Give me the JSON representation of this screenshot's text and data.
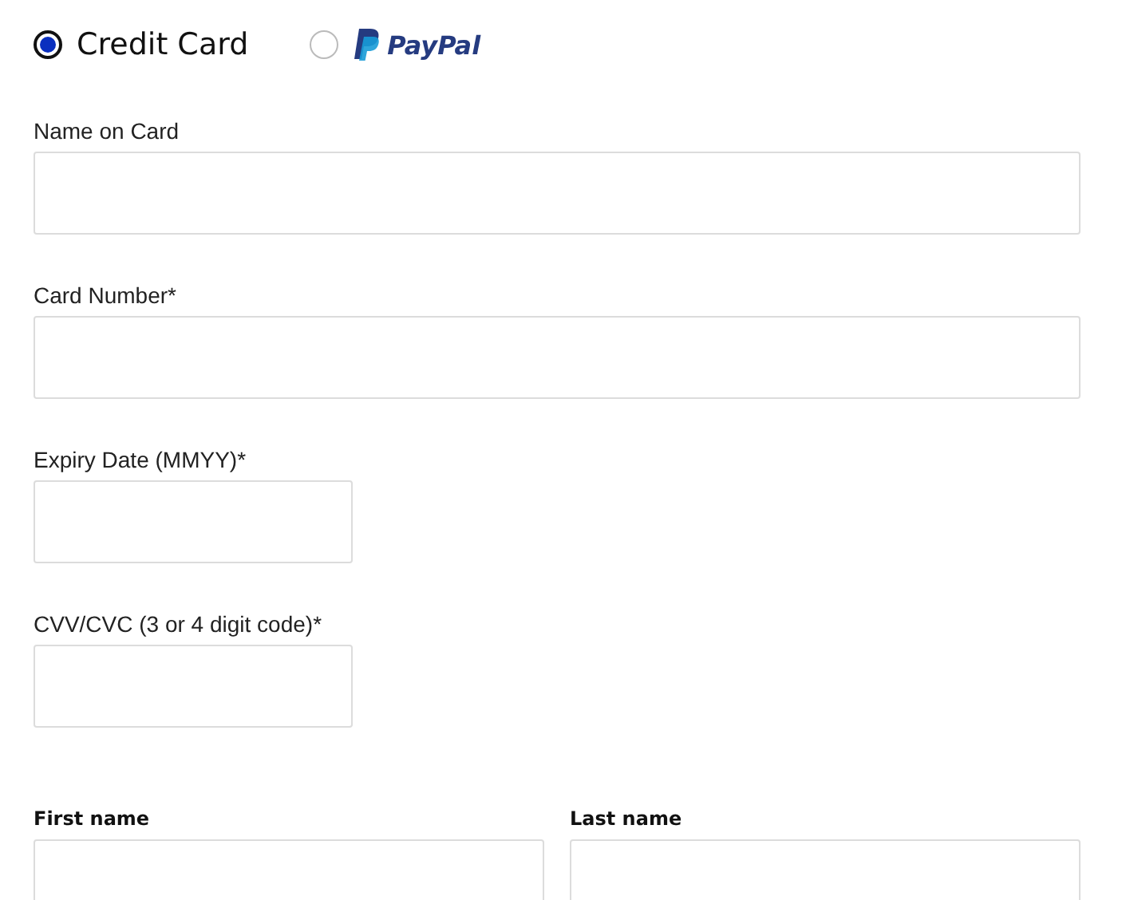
{
  "payment_methods": [
    {
      "label": "Credit Card",
      "selected": true,
      "kind": "text"
    },
    {
      "label": "PayPal",
      "selected": false,
      "kind": "logo"
    }
  ],
  "card_fields": [
    {
      "label": "Name on Card",
      "kind": "wide"
    },
    {
      "label": "Card Number*",
      "kind": "wide"
    },
    {
      "label": "Expiry Date (MMYY)*",
      "kind": "narrow"
    },
    {
      "label": "CVV/CVC (3 or 4 digit code)*",
      "kind": "narrow"
    }
  ],
  "name_fields": [
    {
      "label": "First name"
    },
    {
      "label": "Last name"
    }
  ]
}
